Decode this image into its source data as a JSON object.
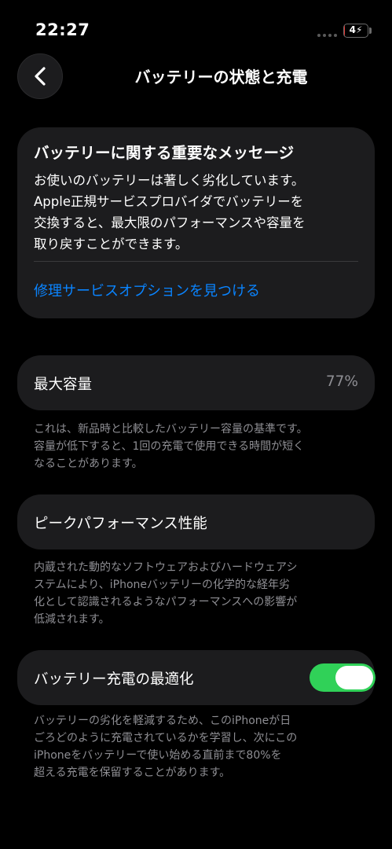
{
  "status_bar": {
    "time": "22:27",
    "battery_level": "4",
    "battery_fraction": 0.04
  },
  "nav": {
    "back_icon": "chevron-left-icon",
    "title": "バッテリーの状態と充電"
  },
  "message_card": {
    "title": "バッテリーに関する重要なメッセージ",
    "body_lines": [
      "お使いのバッテリーは著しく劣化しています。",
      "Apple正規サービスプロバイダでバッテリーを",
      "交換すると、最大限のパフォーマンスや容量を",
      "取り戻すことができます。"
    ],
    "link": "修理サービスオプションを見つける"
  },
  "max_capacity": {
    "label": "最大容量",
    "value": "77%",
    "footnote_lines": [
      "これは、新品時と比較したバッテリー容量の基準です。",
      "容量が低下すると、1回の充電で使用できる時間が短く",
      "なることがあります。"
    ]
  },
  "peak_performance": {
    "label": "ピークパフォーマンス性能",
    "footnote_lines": [
      "内蔵された動的なソフトウェアおよびハードウェアシ",
      "ステムにより、iPhoneバッテリーの化学的な経年劣",
      "化として認識されるようなパフォーマンスへの影響が",
      "低減されます。"
    ]
  },
  "optimized_charging": {
    "label": "バッテリー充電の最適化",
    "enabled": true,
    "footnote_lines": [
      "バッテリーの劣化を軽減するため、このiPhoneが日",
      "ごろどのように充電されているかを学習し、次にこの",
      "iPhoneをバッテリーで使い始める直前まで80%を",
      "超える充電を保留することがあります。"
    ]
  },
  "colors": {
    "background": "#000000",
    "card": "#1c1c1e",
    "link": "#0a84ff",
    "toggle_on": "#30d158",
    "secondary_text": "#8e8e93",
    "battery_low": "#e53935"
  }
}
